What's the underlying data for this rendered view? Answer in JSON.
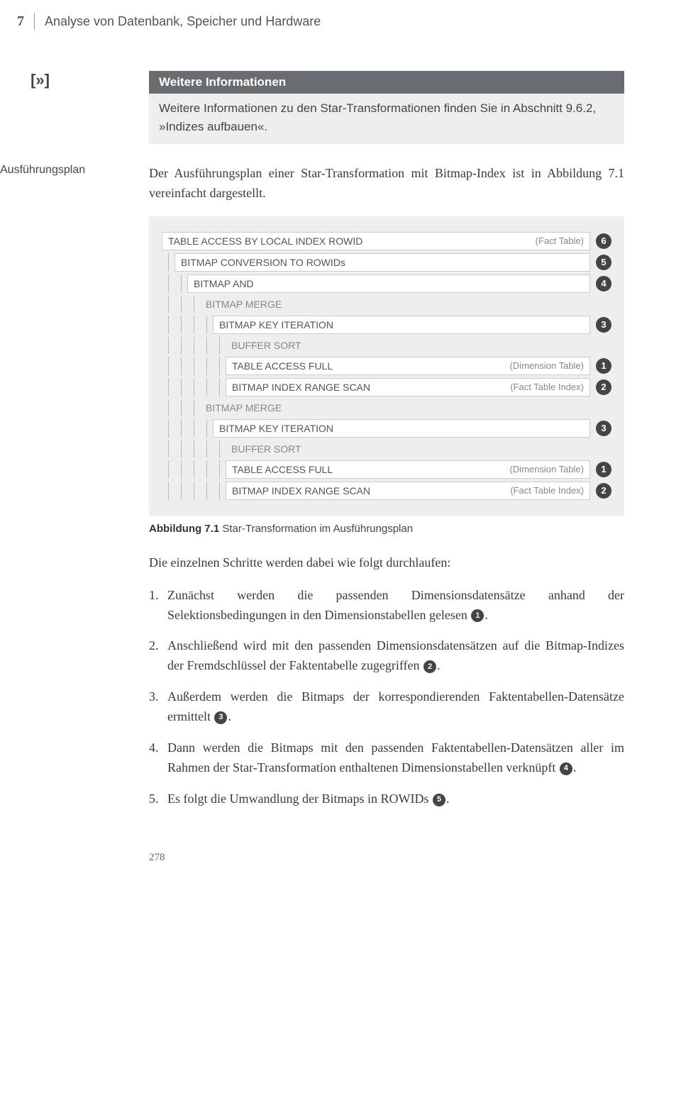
{
  "header": {
    "chapter_number": "7",
    "chapter_title": "Analyse von Datenbank, Speicher und Hardware"
  },
  "xref_icon": "[»]",
  "info_box": {
    "title": "Weitere Informationen",
    "body": "Weitere Informationen zu den Star-Transformationen finden Sie in Abschnitt 9.6.2, »Indizes aufbauen«."
  },
  "margin_label": "Ausführungsplan",
  "intro_paragraph": "Der Ausführungsplan einer Star-Transformation mit Bitmap-Index ist in Abbildung 7.1 vereinfacht dargestellt.",
  "plan": [
    {
      "indent": 0,
      "bordered": true,
      "label": "TABLE ACCESS BY LOCAL INDEX ROWID",
      "right": "(Fact Table)",
      "badge": "6"
    },
    {
      "indent": 1,
      "bordered": true,
      "label": "BITMAP CONVERSION TO ROWIDs",
      "right": "",
      "badge": "5"
    },
    {
      "indent": 2,
      "bordered": true,
      "label": "BITMAP AND",
      "right": "",
      "badge": "4"
    },
    {
      "indent": 3,
      "bordered": false,
      "label": "BITMAP MERGE",
      "right": "",
      "badge": ""
    },
    {
      "indent": 4,
      "bordered": true,
      "label": "BITMAP KEY ITERATION",
      "right": "",
      "badge": "3"
    },
    {
      "indent": 5,
      "bordered": false,
      "label": "BUFFER SORT",
      "right": "",
      "badge": ""
    },
    {
      "indent": 5,
      "bordered": true,
      "label": "TABLE ACCESS FULL",
      "right": "(Dimension Table)",
      "badge": "1"
    },
    {
      "indent": 5,
      "bordered": true,
      "label": "BITMAP INDEX RANGE SCAN",
      "right": "(Fact Table Index)",
      "badge": "2"
    },
    {
      "indent": 3,
      "bordered": false,
      "label": "BITMAP MERGE",
      "right": "",
      "badge": ""
    },
    {
      "indent": 4,
      "bordered": true,
      "label": "BITMAP KEY ITERATION",
      "right": "",
      "badge": "3"
    },
    {
      "indent": 5,
      "bordered": false,
      "label": "BUFFER SORT",
      "right": "",
      "badge": ""
    },
    {
      "indent": 5,
      "bordered": true,
      "label": "TABLE ACCESS FULL",
      "right": "(Dimension Table)",
      "badge": "1"
    },
    {
      "indent": 5,
      "bordered": true,
      "label": "BITMAP INDEX RANGE SCAN",
      "right": "(Fact Table Index)",
      "badge": "2"
    }
  ],
  "figure_caption": {
    "bold": "Abbildung 7.1",
    "rest": " Star-Transformation im Ausführungsplan"
  },
  "steps_intro": "Die einzelnen Schritte werden dabei wie folgt durchlaufen:",
  "steps": [
    {
      "num": "1.",
      "text_a": "Zunächst werden die passenden Dimensionsdatensätze anhand der Selektionsbedingungen in den Dimensionstabellen gelesen ",
      "badge": "1",
      "text_b": "."
    },
    {
      "num": "2.",
      "text_a": "Anschließend wird mit den passenden Dimensionsdatensätzen auf die Bitmap-Indizes der Fremdschlüssel der Faktentabelle zugegriffen ",
      "badge": "2",
      "text_b": "."
    },
    {
      "num": "3.",
      "text_a": "Außerdem werden die Bitmaps der korrespondierenden Faktentabellen-Datensätze ermittelt ",
      "badge": "3",
      "text_b": "."
    },
    {
      "num": "4.",
      "text_a": "Dann werden die Bitmaps mit den passenden Faktentabellen-Datensätzen aller im Rahmen der Star-Transformation enthaltenen Dimensionstabellen verknüpft ",
      "badge": "4",
      "text_b": "."
    },
    {
      "num": "5.",
      "text_a": "Es folgt die Umwandlung der Bitmaps in ROWIDs ",
      "badge": "5",
      "text_b": "."
    }
  ],
  "page_number": "278"
}
